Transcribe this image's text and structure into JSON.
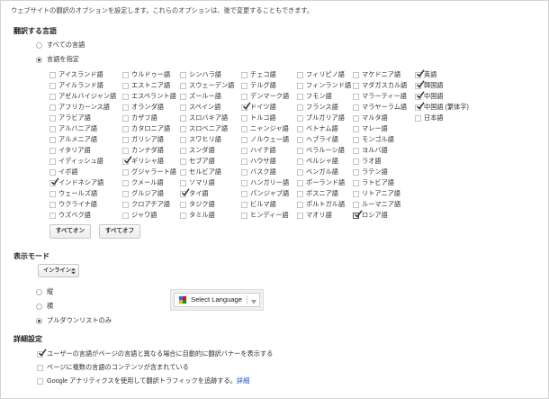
{
  "intro": "ウェブサイトの翻訳のオプションを設定します。これらのオプションは、後で変更することもできます。",
  "colors": {
    "text": "#333333",
    "link": "#1155cc"
  },
  "languages": {
    "title": "翻訳する言語",
    "scope": [
      {
        "label": "すべての言語",
        "selected": false
      },
      {
        "label": "言語を指定",
        "selected": true
      }
    ],
    "columns": [
      [
        {
          "label": "アイスランド語",
          "checked": false
        },
        {
          "label": "アイルランド語",
          "checked": false
        },
        {
          "label": "アゼルバイジャン語",
          "checked": false
        },
        {
          "label": "アフリカーンス語",
          "checked": false
        },
        {
          "label": "アラビア語",
          "checked": false
        },
        {
          "label": "アルバニア語",
          "checked": false
        },
        {
          "label": "アルメニア語",
          "checked": false
        },
        {
          "label": "イタリア語",
          "checked": false
        },
        {
          "label": "イディッシュ語",
          "checked": false
        },
        {
          "label": "イボ語",
          "checked": false
        },
        {
          "label": "インドネシア語",
          "checked": true
        },
        {
          "label": "ウェールズ語",
          "checked": false
        },
        {
          "label": "ウクライナ語",
          "checked": false
        },
        {
          "label": "ウズベク語",
          "checked": false
        }
      ],
      [
        {
          "label": "ウルドゥー語",
          "checked": false
        },
        {
          "label": "エストニア語",
          "checked": false
        },
        {
          "label": "エスペラント語",
          "checked": false
        },
        {
          "label": "オランダ語",
          "checked": false
        },
        {
          "label": "カザフ語",
          "checked": false
        },
        {
          "label": "カタロニア語",
          "checked": false
        },
        {
          "label": "ガリシア語",
          "checked": false
        },
        {
          "label": "カンナダ語",
          "checked": false
        },
        {
          "label": "ギリシャ語",
          "checked": true
        },
        {
          "label": "グジャラート語",
          "checked": false
        },
        {
          "label": "クメール語",
          "checked": false
        },
        {
          "label": "グルジア語",
          "checked": false
        },
        {
          "label": "クロアチア語",
          "checked": false
        },
        {
          "label": "ジャワ語",
          "checked": false
        }
      ],
      [
        {
          "label": "シンハラ語",
          "checked": false
        },
        {
          "label": "スウェーデン語",
          "checked": false
        },
        {
          "label": "ズールー語",
          "checked": false
        },
        {
          "label": "スペイン語",
          "checked": false
        },
        {
          "label": "スロバキア語",
          "checked": false
        },
        {
          "label": "スロベニア語",
          "checked": false
        },
        {
          "label": "スワヒリ語",
          "checked": false
        },
        {
          "label": "スンダ語",
          "checked": false
        },
        {
          "label": "セブア語",
          "checked": false
        },
        {
          "label": "セルビア語",
          "checked": false
        },
        {
          "label": "ソマリ語",
          "checked": false
        },
        {
          "label": "タイ語",
          "checked": true
        },
        {
          "label": "タジク語",
          "checked": false
        },
        {
          "label": "タミル語",
          "checked": false
        }
      ],
      [
        {
          "label": "チェコ語",
          "checked": false
        },
        {
          "label": "テルグ語",
          "checked": false
        },
        {
          "label": "デンマーク語",
          "checked": false
        },
        {
          "label": "ドイツ語",
          "checked": true
        },
        {
          "label": "トルコ語",
          "checked": false
        },
        {
          "label": "ニャンジャ語",
          "checked": false
        },
        {
          "label": "ノルウェー語",
          "checked": false
        },
        {
          "label": "ハイチ語",
          "checked": false
        },
        {
          "label": "ハウサ語",
          "checked": false
        },
        {
          "label": "バスク語",
          "checked": false
        },
        {
          "label": "ハンガリー語",
          "checked": false
        },
        {
          "label": "パンジャブ語",
          "checked": false
        },
        {
          "label": "ビルマ語",
          "checked": false
        },
        {
          "label": "ヒンディー語",
          "checked": false
        }
      ],
      [
        {
          "label": "フィリピノ語",
          "checked": false
        },
        {
          "label": "フィンランド語",
          "checked": false
        },
        {
          "label": "フモン語",
          "checked": false
        },
        {
          "label": "フランス語",
          "checked": false
        },
        {
          "label": "ブルガリア語",
          "checked": false
        },
        {
          "label": "ベトナム語",
          "checked": false
        },
        {
          "label": "ヘブライ語",
          "checked": false
        },
        {
          "label": "ベラルーシ語",
          "checked": false
        },
        {
          "label": "ペルシャ語",
          "checked": false
        },
        {
          "label": "ベンガル語",
          "checked": false
        },
        {
          "label": "ポーランド語",
          "checked": false
        },
        {
          "label": "ボスニア語",
          "checked": false
        },
        {
          "label": "ポルトガル語",
          "checked": false
        },
        {
          "label": "マオリ語",
          "checked": false
        }
      ],
      [
        {
          "label": "マケドニア語",
          "checked": false
        },
        {
          "label": "マダガスカル語",
          "checked": false
        },
        {
          "label": "マラーティー語",
          "checked": false
        },
        {
          "label": "マラヤーラム語",
          "checked": false
        },
        {
          "label": "マルタ語",
          "checked": false
        },
        {
          "label": "マレー語",
          "checked": false
        },
        {
          "label": "モンゴル語",
          "checked": false
        },
        {
          "label": "ヨルバ語",
          "checked": false
        },
        {
          "label": "ラオ語",
          "checked": false
        },
        {
          "label": "ラテン語",
          "checked": false
        },
        {
          "label": "ラトビア語",
          "checked": false
        },
        {
          "label": "リトアニア語",
          "checked": false
        },
        {
          "label": "ルーマニア語",
          "checked": false
        },
        {
          "label": "ロシア語",
          "checked": true,
          "focused": true
        }
      ],
      [
        {
          "label": "英語",
          "checked": true
        },
        {
          "label": "韓国語",
          "checked": true
        },
        {
          "label": "中国語",
          "checked": true
        },
        {
          "label": "中国語 (繁体字)",
          "checked": true
        },
        {
          "label": "日本語",
          "checked": false
        }
      ]
    ],
    "buttons": {
      "all_on": "すべてオン",
      "all_off": "すべてオフ"
    }
  },
  "display_mode": {
    "title": "表示モード",
    "select_value": "インライン",
    "select_icon": "up-down-arrows-icon",
    "options": [
      {
        "label": "縦",
        "selected": false
      },
      {
        "label": "横",
        "selected": false
      },
      {
        "label": "プルダウンリストのみ",
        "selected": true
      }
    ],
    "preview": {
      "icon": "google-translate-icon",
      "label": "Select Language",
      "arrow_icon": "dropdown-arrow-icon"
    }
  },
  "advanced": {
    "title": "詳細設定",
    "options": [
      {
        "label": "ユーザーの言語がページの言語と異なる場合に自動的に翻訳バナーを表示する",
        "checked": true
      },
      {
        "label": "ページに複数の言語のコンテンツが含まれている",
        "checked": false
      },
      {
        "label": "Google アナリティクスを使用して翻訳トラフィックを追跡する。",
        "checked": false,
        "link": "詳細"
      }
    ]
  }
}
